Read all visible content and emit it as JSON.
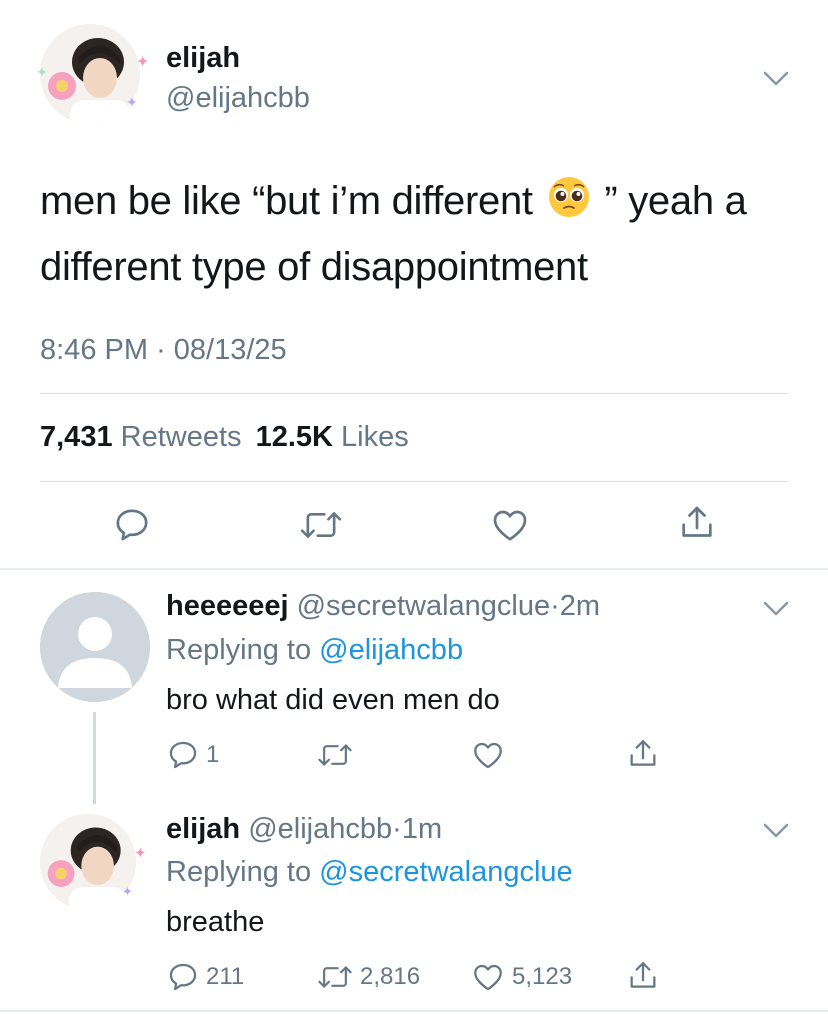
{
  "main_tweet": {
    "author_name": "elijah",
    "author_handle": "@elijahcbb",
    "text_before_emoji": "men be like “but i’m different",
    "emoji": "pleading-face-emoji",
    "text_after_emoji": "” yeah a different type of disappointment",
    "time": "8:46 PM",
    "date_sep": "·",
    "date": "08/13/25",
    "retweets_count": "7,431",
    "retweets_label": "Retweets",
    "likes_count": "12.5K",
    "likes_label": "Likes",
    "icons": [
      "reply-icon",
      "retweet-icon",
      "like-icon",
      "share-icon"
    ]
  },
  "replies": [
    {
      "author_name": "heeeeeej",
      "author_handle": "@secretwalangclue",
      "dot": "·",
      "time": "2m",
      "replying_prefix": "Replying to",
      "replying_to": "@elijahcbb",
      "text": "bro what did even men do",
      "reply_count": "1",
      "retweet_count": "",
      "like_count": "",
      "avatar": "default-avatar"
    },
    {
      "author_name": "elijah",
      "author_handle": "@elijahcbb",
      "dot": "·",
      "time": "1m",
      "replying_prefix": "Replying to",
      "replying_to": "@secretwalangclue",
      "text": "breathe",
      "reply_count": "211",
      "retweet_count": "2,816",
      "like_count": "5,123",
      "avatar": "profile-photo"
    }
  ],
  "colors": {
    "text": "#14171a",
    "secondary": "#657786",
    "link": "#1b95e0",
    "divider": "#e6ecf0"
  }
}
